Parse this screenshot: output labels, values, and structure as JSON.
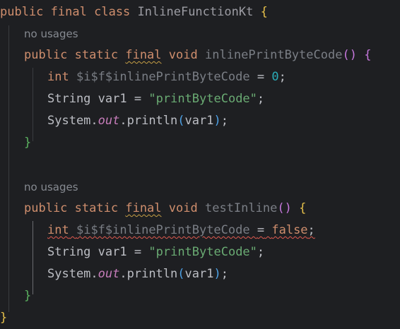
{
  "class_decl": {
    "kw_public": "public",
    "kw_final": "final",
    "kw_class": "class",
    "name": "InlineFunctionKt",
    "open_brace": "{",
    "close_brace": "}"
  },
  "methods": [
    {
      "usage_hint": "no usages",
      "kw_public": "public",
      "kw_static": "static",
      "kw_final": "final",
      "kw_void": "void",
      "name": "inlinePrintByteCode",
      "parens_open": "(",
      "parens_close": ")",
      "open_brace": "{",
      "close_brace": "}",
      "stmt1": {
        "type": "int",
        "var": "$i$f$inlinePrintByteCode",
        "eq": "=",
        "value": "0",
        "semi": ";"
      },
      "stmt2": {
        "type": "String",
        "var": "var1",
        "eq": "=",
        "value": "\"printByteCode\"",
        "semi": ";"
      },
      "stmt3": {
        "obj": "System.",
        "field": "out",
        "call": ".println",
        "po": "(",
        "arg": "var1",
        "pc": ")",
        "semi": ";"
      }
    },
    {
      "usage_hint": "no usages",
      "kw_public": "public",
      "kw_static": "static",
      "kw_final": "final",
      "kw_void": "void",
      "name": "testInline",
      "parens_open": "(",
      "parens_close": ")",
      "open_brace": "{",
      "close_brace": "}",
      "stmt1": {
        "type": "int",
        "var": "$i$f$inlinePrintByteCode",
        "eq": "=",
        "value": "false",
        "semi": ";"
      },
      "stmt2": {
        "type": "String",
        "var": "var1",
        "eq": "=",
        "value": "\"printByteCode\"",
        "semi": ";"
      },
      "stmt3": {
        "obj": "System.",
        "field": "out",
        "call": ".println",
        "po": "(",
        "arg": "var1",
        "pc": ")",
        "semi": ";"
      }
    }
  ]
}
